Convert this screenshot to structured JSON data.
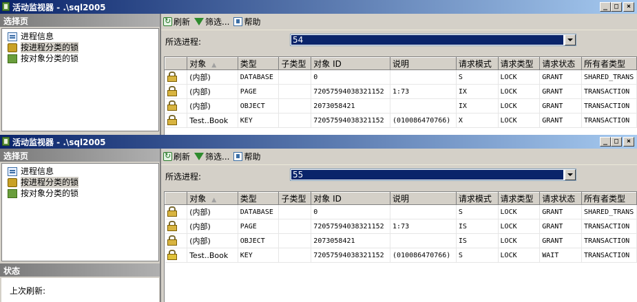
{
  "windows": [
    {
      "title": "活动监视器 - .\\sql2005",
      "left_header": "选择页",
      "nav_items": [
        {
          "label": "进程信息",
          "icon": "process-icon"
        },
        {
          "label": "按进程分类的锁",
          "icon": "lock-icon",
          "selected": true
        },
        {
          "label": "按对象分类的锁",
          "icon": "object-icon"
        }
      ],
      "toolbar": {
        "refresh": "刷新",
        "filter": "筛选...",
        "help": "帮助"
      },
      "selected_process_label": "所选进程:",
      "selected_process_value": "54",
      "columns": [
        "",
        "对象",
        "类型",
        "子类型",
        "对象 ID",
        "说明",
        "请求模式",
        "请求类型",
        "请求状态",
        "所有者类型"
      ],
      "rows": [
        [
          "(内部)",
          "DATABASE",
          "",
          "0",
          "",
          "S",
          "LOCK",
          "GRANT",
          "SHARED_TRANS"
        ],
        [
          "(内部)",
          "PAGE",
          "",
          "72057594038321152",
          "1:73",
          "IX",
          "LOCK",
          "GRANT",
          "TRANSACTION"
        ],
        [
          "(内部)",
          "OBJECT",
          "",
          "2073058421",
          "",
          "IX",
          "LOCK",
          "GRANT",
          "TRANSACTION"
        ],
        [
          "Test..Book",
          "KEY",
          "",
          "72057594038321152",
          "(010086470766)",
          "X",
          "LOCK",
          "GRANT",
          "TRANSACTION"
        ]
      ]
    },
    {
      "title": "活动监视器 - .\\sql2005",
      "left_header": "选择页",
      "nav_items": [
        {
          "label": "进程信息",
          "icon": "process-icon"
        },
        {
          "label": "按进程分类的锁",
          "icon": "lock-icon",
          "selected": true
        },
        {
          "label": "按对象分类的锁",
          "icon": "object-icon"
        }
      ],
      "toolbar": {
        "refresh": "刷新",
        "filter": "筛选...",
        "help": "帮助"
      },
      "selected_process_label": "所选进程:",
      "selected_process_value": "55",
      "columns": [
        "",
        "对象",
        "类型",
        "子类型",
        "对象 ID",
        "说明",
        "请求模式",
        "请求类型",
        "请求状态",
        "所有者类型"
      ],
      "rows": [
        [
          "(内部)",
          "DATABASE",
          "",
          "0",
          "",
          "S",
          "LOCK",
          "GRANT",
          "SHARED_TRANS"
        ],
        [
          "(内部)",
          "PAGE",
          "",
          "72057594038321152",
          "1:73",
          "IS",
          "LOCK",
          "GRANT",
          "TRANSACTION"
        ],
        [
          "(内部)",
          "OBJECT",
          "",
          "2073058421",
          "",
          "IS",
          "LOCK",
          "GRANT",
          "TRANSACTION"
        ],
        [
          "Test..Book",
          "KEY",
          "",
          "72057594038321152",
          "(010086470766)",
          "S",
          "LOCK",
          "WAIT",
          "TRANSACTION"
        ]
      ],
      "status_header": "状态",
      "last_refresh_label": "上次刷新:"
    }
  ],
  "colors": {
    "title_bar": "#0a246a",
    "selection": "#0a246a",
    "panel_header": "#808080"
  }
}
